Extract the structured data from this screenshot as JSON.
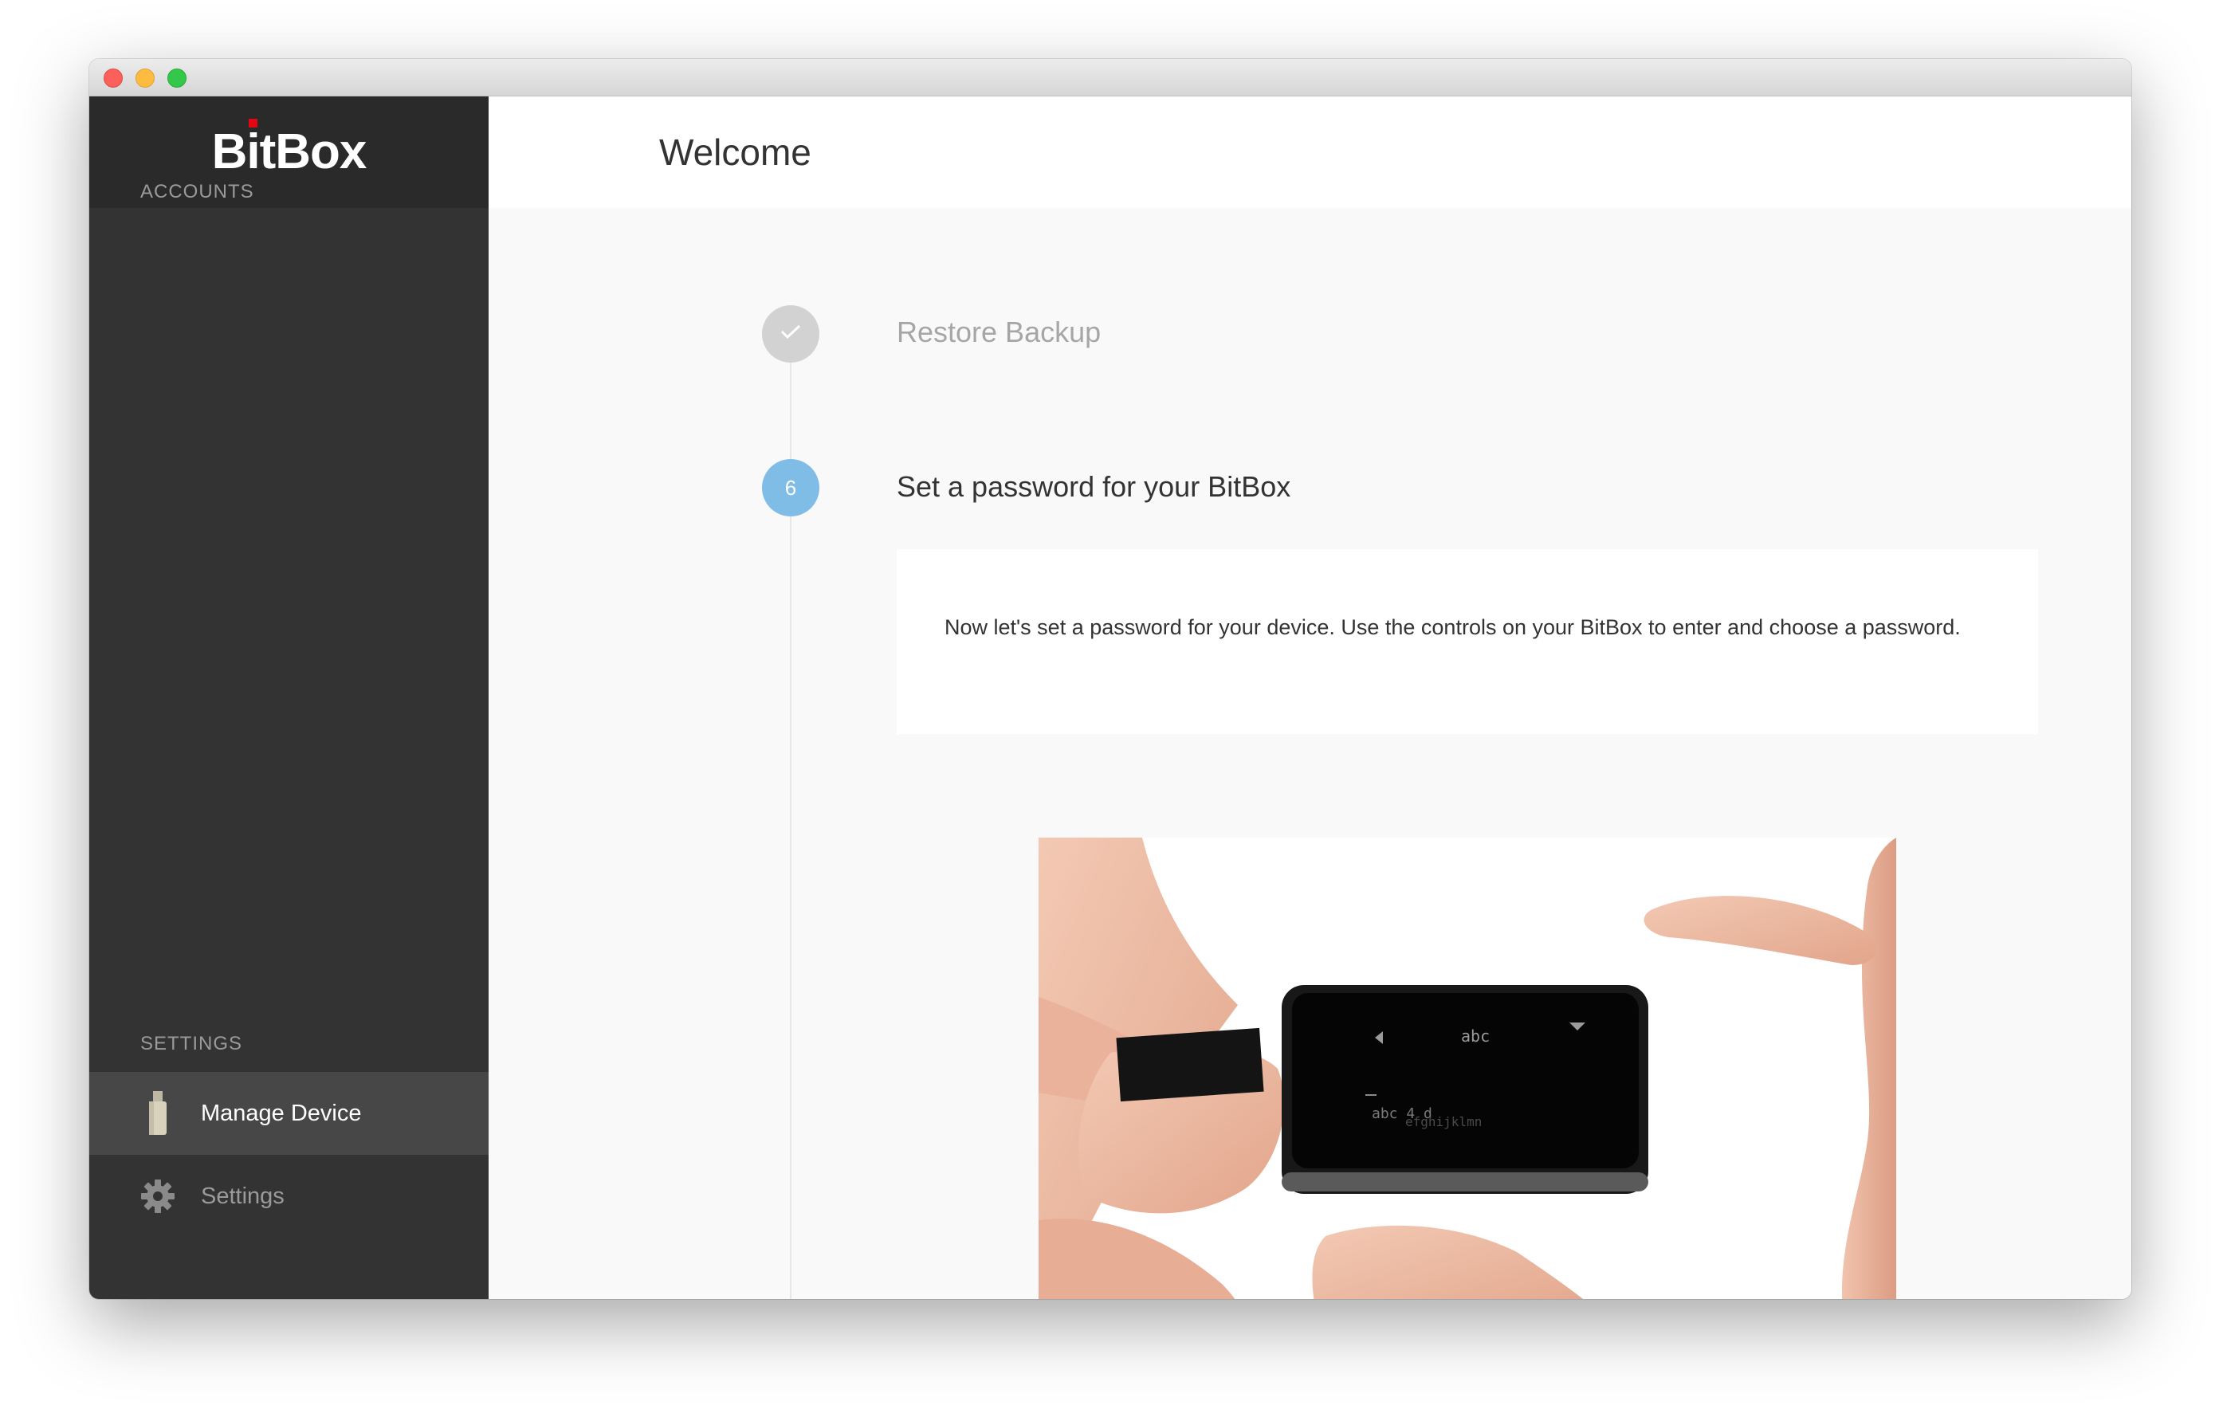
{
  "window": {
    "controls": [
      "close",
      "minimize",
      "maximize"
    ]
  },
  "sidebar": {
    "logo": {
      "part1": "B",
      "part2": "i",
      "part3": "tBox"
    },
    "accounts_label": "ACCOUNTS",
    "settings_label": "SETTINGS",
    "items": [
      {
        "label": "Manage Device",
        "icon": "usb-stick-icon",
        "active": true
      },
      {
        "label": "Settings",
        "icon": "gear-icon",
        "active": false
      }
    ]
  },
  "main": {
    "title": "Welcome",
    "steps": [
      {
        "label": "Restore Backup",
        "status": "done",
        "icon": "checkmark-icon"
      },
      {
        "number": "6",
        "label": "Set a password for your BitBox",
        "status": "current"
      }
    ],
    "card": {
      "text": "Now let's set a password for your device. Use the controls on your BitBox to enter and choose a password."
    },
    "illustration": {
      "device_screen": {
        "top_text": "abc",
        "bottom_text": "abc 4 d",
        "bottom_text_2": "efghijklmn"
      }
    }
  },
  "colors": {
    "sidebar_bg": "#333333",
    "sidebar_header_bg": "#2a2a2a",
    "active_item_bg": "#474747",
    "logo_dot": "#e30613",
    "step_current": "#7fbde6",
    "step_done": "#d2d2d2"
  }
}
